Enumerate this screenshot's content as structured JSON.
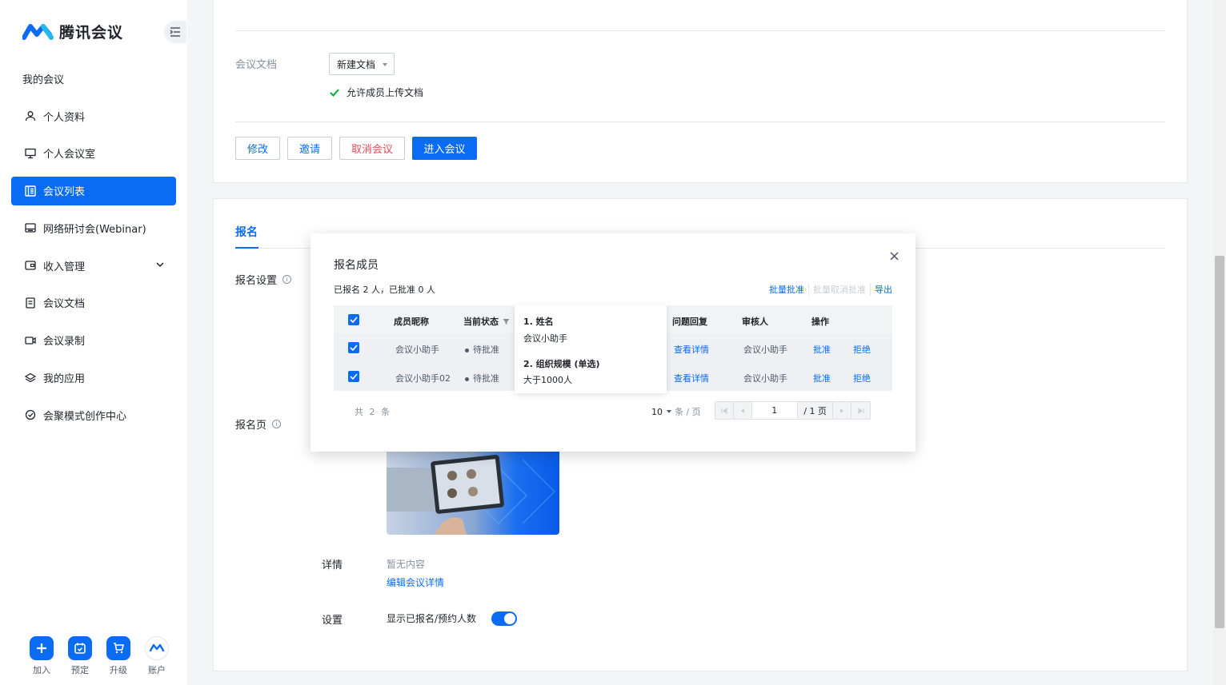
{
  "app": {
    "name": "腾讯会议"
  },
  "sidebar": {
    "section_title": "我的会议",
    "items": [
      {
        "label": "个人资料",
        "icon": "user-icon"
      },
      {
        "label": "个人会议室",
        "icon": "monitor-icon"
      },
      {
        "label": "会议列表",
        "icon": "list-icon",
        "active": true
      },
      {
        "label": "网络研讨会(Webinar)",
        "icon": "webinar-icon"
      },
      {
        "label": "收入管理",
        "icon": "wallet-icon",
        "expandable": true
      },
      {
        "label": "会议文档",
        "icon": "document-icon"
      },
      {
        "label": "会议录制",
        "icon": "video-icon"
      },
      {
        "label": "我的应用",
        "icon": "layers-icon"
      },
      {
        "label": "会聚模式创作中心",
        "icon": "creator-icon"
      }
    ],
    "bottom": [
      {
        "label": "加入",
        "icon": "plus-icon"
      },
      {
        "label": "预定",
        "icon": "calendar-icon"
      },
      {
        "label": "升级",
        "icon": "cart-icon"
      },
      {
        "label": "账户",
        "icon": "avatar-icon"
      }
    ]
  },
  "meeting": {
    "doc_label": "会议文档",
    "doc_select": "新建文档",
    "allow_upload": "允许成员上传文档",
    "buttons": {
      "modify": "修改",
      "invite": "邀请",
      "cancel": "取消会议",
      "enter": "进入会议"
    }
  },
  "registration": {
    "tab": "报名",
    "settings_label": "报名设置",
    "page_label": "报名页",
    "detail_label": "详情",
    "detail_empty": "暂无内容",
    "edit_detail_link": "编辑会议详情",
    "setting_label": "设置",
    "show_count_label": "显示已报名/预约人数",
    "show_count_enabled": true
  },
  "modal": {
    "title": "报名成员",
    "close": "×",
    "summary": "已报名 2 人，已批准 0 人",
    "actions": {
      "batch_approve": "批量批准",
      "batch_unapprove": "批量取消批准",
      "export": "导出"
    },
    "columns": [
      "成员昵称",
      "当前状态",
      "问题回复",
      "审核人",
      "操作"
    ],
    "rows": [
      {
        "nickname": "会议小助手",
        "status": "待批准",
        "reply": "查看详情",
        "reviewer": "会议小助手",
        "approve": "批准",
        "reject": "拒绝"
      },
      {
        "nickname": "会议小助手02",
        "status": "待批准",
        "reply": "查看详情",
        "reviewer": "会议小助手",
        "approve": "批准",
        "reject": "拒绝"
      }
    ],
    "tooltip": {
      "q1": "1. 姓名",
      "a1": "会议小助手",
      "q2": "2. 组织规模 (单选)",
      "a2": "大于1000人"
    },
    "pager": {
      "total": "共 2 条",
      "page_size": "10",
      "page_size_unit": "条 / 页",
      "current_page": "1",
      "total_pages": "/ 1 页"
    }
  },
  "colors": {
    "primary": "#0a6cf5",
    "danger": "#e34d59"
  }
}
